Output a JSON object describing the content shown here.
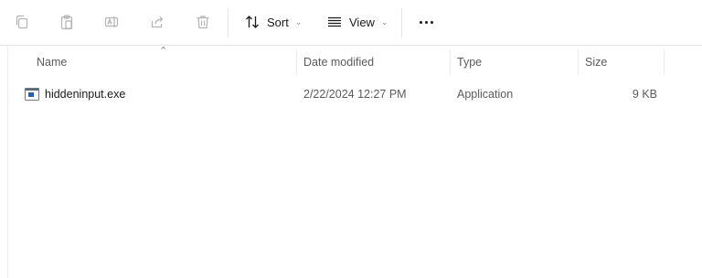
{
  "toolbar": {
    "icons": [
      "copy-icon",
      "paste-icon",
      "rename-icon",
      "share-icon",
      "delete-icon"
    ],
    "sort_label": "Sort",
    "view_label": "View",
    "more_icon": "more-icon",
    "colors": {
      "disabled_icon": "#b3b3b3",
      "icon": "#1a1a1a"
    }
  },
  "columns": {
    "name": "Name",
    "date_modified": "Date modified",
    "type": "Type",
    "size": "Size"
  },
  "files": [
    {
      "name": "hiddeninput.exe",
      "date_modified": "2/22/2024 12:27 PM",
      "type": "Application",
      "size": "9 KB",
      "icon": "application-icon"
    }
  ]
}
